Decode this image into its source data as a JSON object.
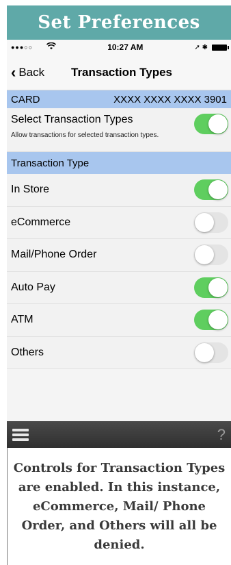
{
  "banner": {
    "title": "Set Preferences"
  },
  "status_bar": {
    "signal": "●●●○○",
    "time": "10:27 AM",
    "icons": "➚ ✱"
  },
  "nav": {
    "back_label": "Back",
    "title": "Transaction Types"
  },
  "card": {
    "label": "CARD",
    "number": "XXXX XXXX XXXX 3901"
  },
  "select_all": {
    "label": "Select Transaction Types",
    "description": "Allow transactions for selected transaction types.",
    "enabled": true
  },
  "section": {
    "header": "Transaction Type"
  },
  "transaction_types": [
    {
      "label": "In Store",
      "enabled": true
    },
    {
      "label": "eCommerce",
      "enabled": false
    },
    {
      "label": "Mail/Phone Order",
      "enabled": false
    },
    {
      "label": "Auto Pay",
      "enabled": true
    },
    {
      "label": "ATM",
      "enabled": true
    },
    {
      "label": "Others",
      "enabled": false
    }
  ],
  "bottom_bar": {
    "help": "?"
  },
  "caption": {
    "text": "Controls for Transaction Types are enabled. In this instance, eCommerce, Mail/ Phone Order, and Others will all be denied."
  },
  "colors": {
    "banner": "#5fa9a8",
    "section_blue": "#a8c6ee",
    "toggle_on": "#5fce5f",
    "toggle_off": "#e4e4e4"
  }
}
